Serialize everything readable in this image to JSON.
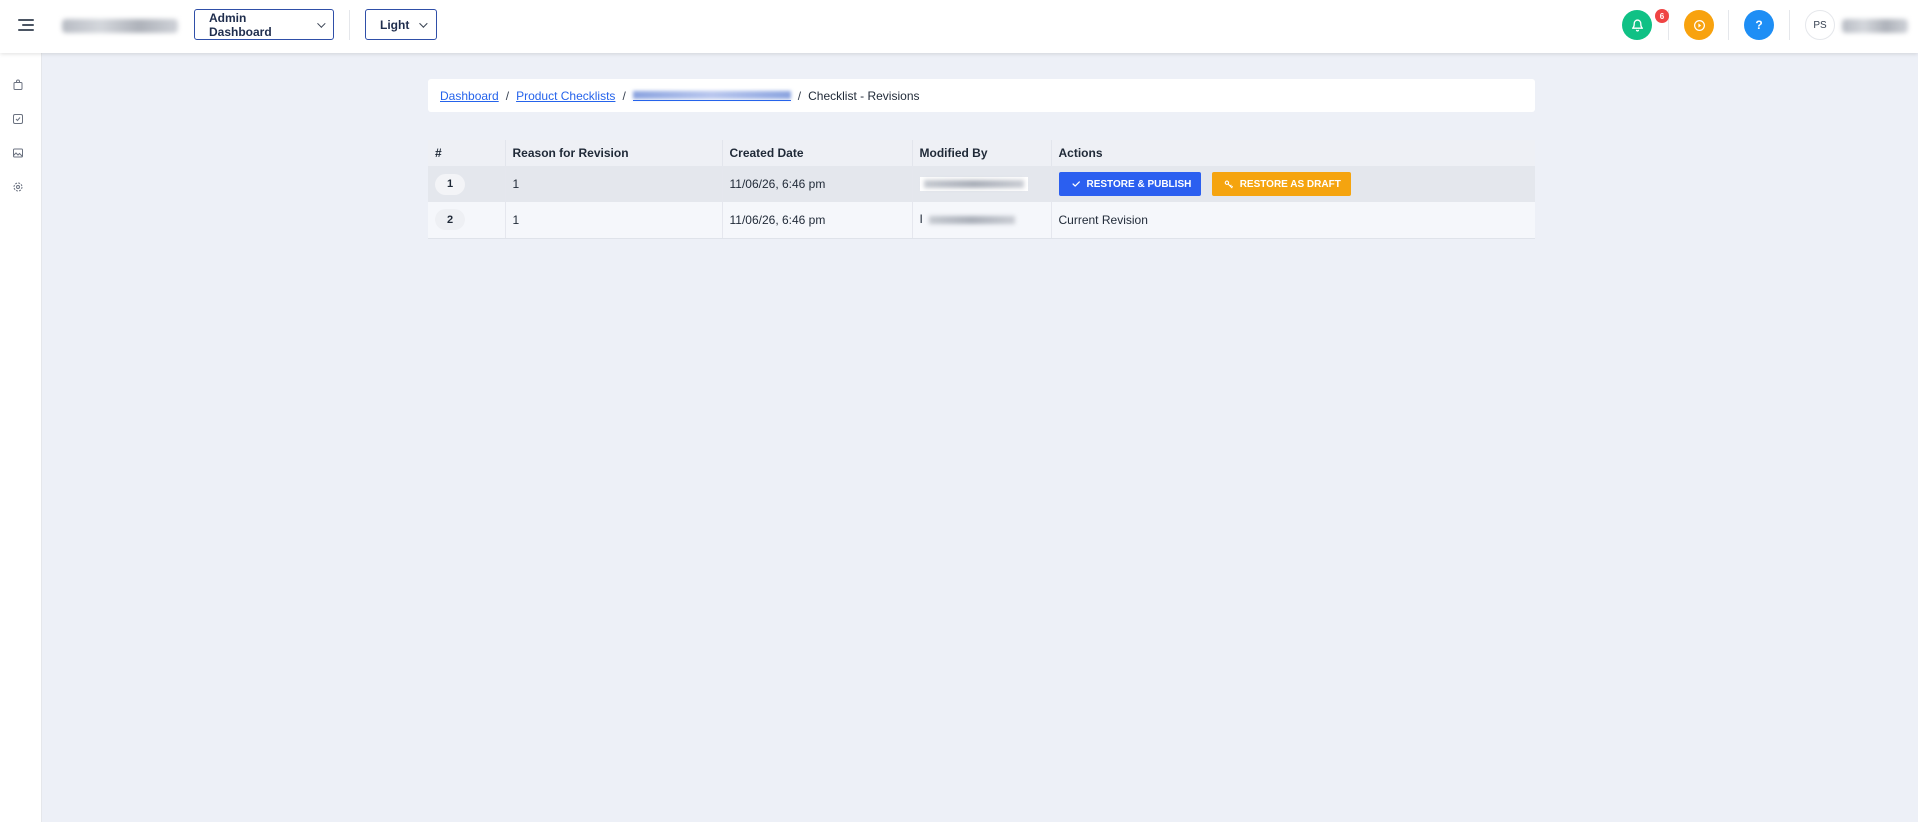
{
  "header": {
    "workspace_select": "Admin Dashboard",
    "theme_select": "Light",
    "notification_count": "6",
    "avatar_initials": "PS"
  },
  "sidebar": {
    "items": [
      "bag-icon",
      "checklist-icon",
      "image-icon",
      "gear-icon"
    ]
  },
  "breadcrumb": {
    "dashboard": "Dashboard",
    "product_checklists": "Product Checklists",
    "separator": "/",
    "current": "Checklist - Revisions"
  },
  "table": {
    "headers": [
      "#",
      "Reason for Revision",
      "Created Date",
      "Modified By",
      "Actions"
    ],
    "rows": [
      {
        "num": "1",
        "reason": "1",
        "created": "11/06/26, 6:46 pm",
        "modified_initial": ""
      },
      {
        "num": "2",
        "reason": "1",
        "created": "11/06/26, 6:46 pm",
        "modified_initial": "I",
        "status": "Current Revision"
      }
    ],
    "restore_publish": "Restore & Publish",
    "restore_draft": "Restore as Draft"
  },
  "colors": {
    "primary": "#2b5ff0",
    "warning": "#f5a40f",
    "notification": "#10c185",
    "coin": "#f8a20e",
    "help": "#1e8ef5",
    "badge": "#ef4444"
  }
}
